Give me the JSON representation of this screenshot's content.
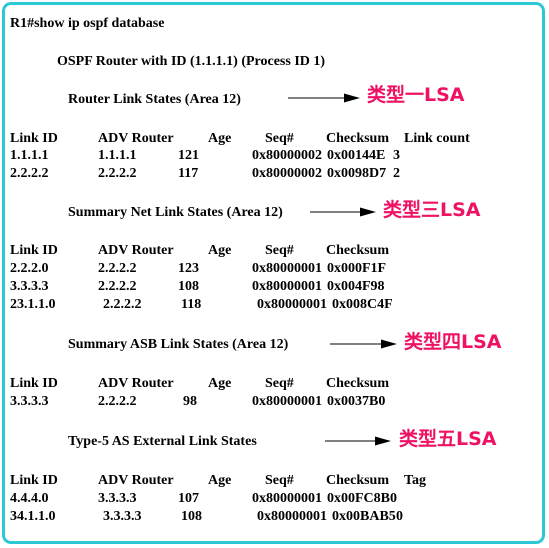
{
  "window": {
    "border_color": "#2cc8d4",
    "background": "#ffffff",
    "text_color": "#000000",
    "annotation_color": "#ee1164"
  },
  "terminal": {
    "prompt_line": "R1#show ip ospf database",
    "router_header": "OSPF Router with ID (1.1.1.1) (Process ID 1)"
  },
  "sections": [
    {
      "title": "Router Link States (Area 12)",
      "annotation": "类型一LSA",
      "columns": [
        "Link ID",
        "ADV Router",
        "Age",
        "Seq#",
        "Checksum",
        "Link count"
      ],
      "rows": [
        [
          "1.1.1.1",
          "1.1.1.1",
          "121",
          "0x80000002",
          "0x00144E",
          "3"
        ],
        [
          "2.2.2.2",
          "2.2.2.2",
          "117",
          "0x80000002",
          "0x0098D7",
          "2"
        ]
      ]
    },
    {
      "title": "Summary Net Link States (Area 12)",
      "annotation": "类型三LSA",
      "columns": [
        "Link ID",
        "ADV Router",
        "Age",
        "Seq#",
        "Checksum"
      ],
      "rows": [
        [
          "2.2.2.0",
          "2.2.2.2",
          "123",
          "0x80000001",
          "0x000F1F"
        ],
        [
          "3.3.3.3",
          "2.2.2.2",
          "108",
          "0x80000001",
          "0x004F98"
        ],
        [
          "23.1.1.0",
          "2.2.2.2",
          "118",
          "0x80000001",
          "0x008C4F"
        ]
      ]
    },
    {
      "title": "Summary ASB Link States (Area 12)",
      "annotation": "类型四LSA",
      "columns": [
        "Link ID",
        "ADV Router",
        "Age",
        "Seq#",
        "Checksum"
      ],
      "rows": [
        [
          "3.3.3.3",
          "2.2.2.2",
          "98",
          "0x80000001",
          "0x0037B0"
        ]
      ]
    },
    {
      "title": "Type-5 AS External Link States",
      "annotation": "类型五LSA",
      "columns": [
        "Link ID",
        "ADV Router",
        "Age",
        "Seq#",
        "Checksum",
        "Tag"
      ],
      "rows": [
        [
          "4.4.4.0",
          "3.3.3.3",
          "107",
          "0x80000001",
          "0x00FC8B",
          "0"
        ],
        [
          "34.1.1.0",
          "3.3.3.3",
          "108",
          "0x80000001",
          "0x00BAB5",
          "0"
        ]
      ]
    }
  ]
}
